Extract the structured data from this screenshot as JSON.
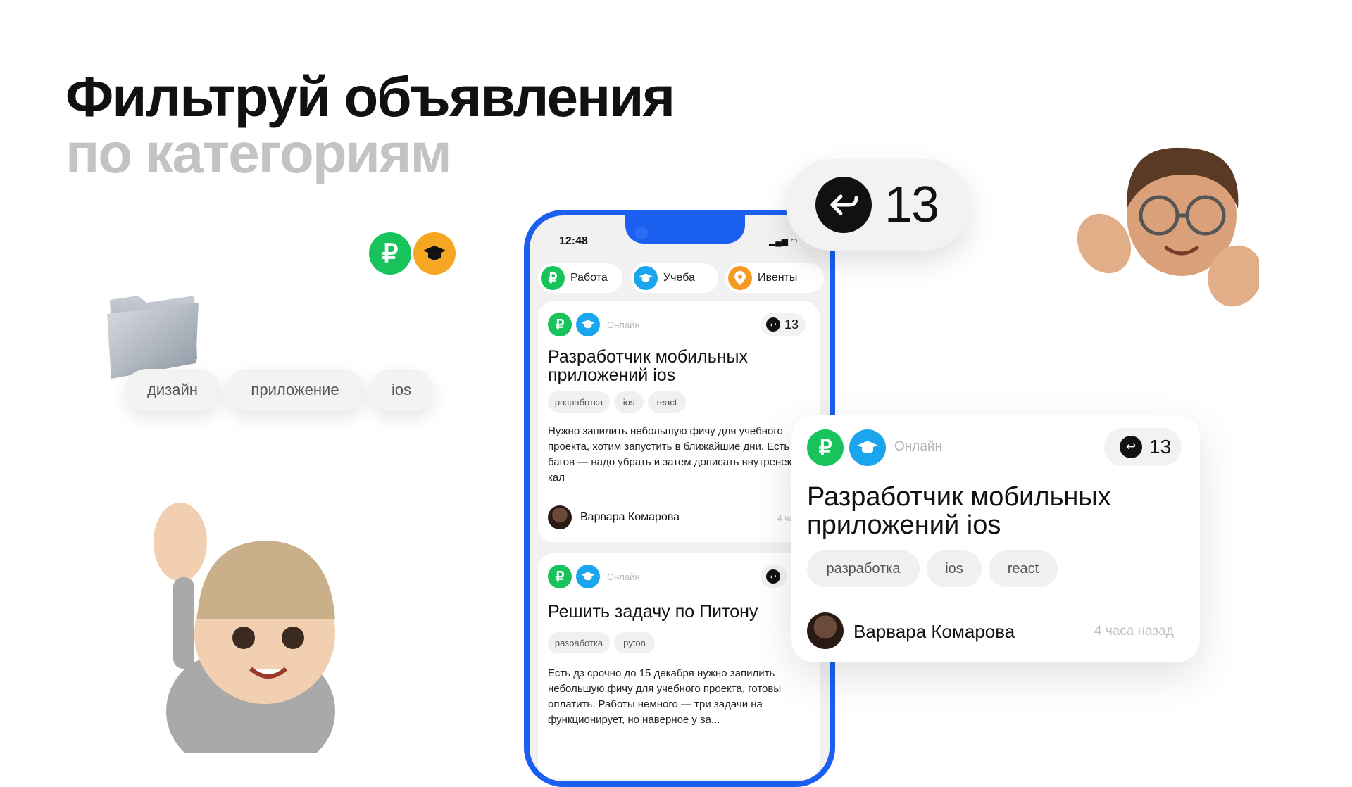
{
  "headline": {
    "line1": "Фильтруй объявления",
    "line2": "по категориям"
  },
  "floating_icons": [
    "ruble-icon",
    "graduation-cap-icon"
  ],
  "floating_tags": [
    "дизайн",
    "приложение",
    "ios"
  ],
  "phone": {
    "time": "12:48",
    "categories": [
      {
        "label": "Работа",
        "icon": "ruble-icon",
        "color": "#17c35a"
      },
      {
        "label": "Учеба",
        "icon": "graduation-cap-icon",
        "color": "#1aa6ee"
      },
      {
        "label": "Ивенты",
        "icon": "location-pin-icon",
        "color": "#f59a23"
      }
    ],
    "cards": [
      {
        "status": "Онлайн",
        "replies": "13",
        "title_line1": "Разработчик мобильных",
        "title_line2": "приложений ios",
        "tags": [
          "разработка",
          "ios",
          "react"
        ],
        "description": "Нужно запилить небольшую фичу для учебного проекта, хотим запустить в ближайшие дни. Есть пару багов — надо убрать и затем дописать внутренекк кал",
        "author": "Варвара Комарова",
        "time": "4 часа"
      },
      {
        "status": "Онлайн",
        "title_line1": "Решить задачу по Питону",
        "tags": [
          "разработка",
          "pyton"
        ],
        "description": "Есть дз срочно до 15 декабря нужно запилить небольшую фичу для учебного проекта, готовы оплатить. Работы немного — три задачи на функционирует, но наверное у sa..."
      }
    ]
  },
  "reply_badge": {
    "count": "13"
  },
  "big_card": {
    "status": "Онлайн",
    "replies": "13",
    "title_line1": "Разработчик мобильных",
    "title_line2": "приложений ios",
    "tags": [
      "разработка",
      "ios",
      "react"
    ],
    "author": "Варвара Комарова",
    "time": "4 часа назад"
  },
  "colors": {
    "brand_blue": "#1a5ff0",
    "work_green": "#17c35a",
    "study_blue": "#1aa6ee",
    "events_orange": "#f59a23"
  }
}
